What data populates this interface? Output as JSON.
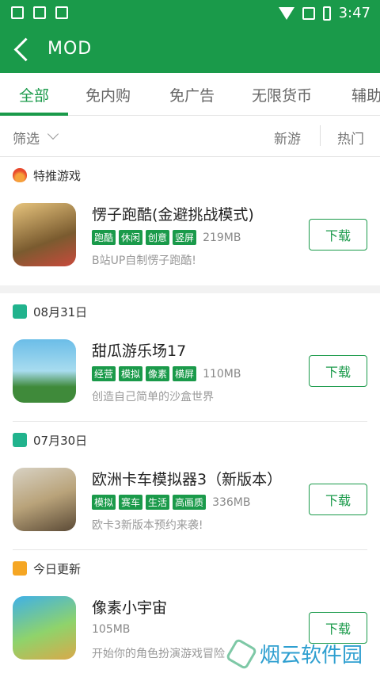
{
  "status": {
    "time": "3:47"
  },
  "appbar": {
    "title": "MOD"
  },
  "tabs": [
    "全部",
    "免内购",
    "免广告",
    "无限货币",
    "辅助"
  ],
  "filter": {
    "label": "筛选",
    "sort_new": "新游",
    "sort_hot": "热门"
  },
  "sections": [
    {
      "title": "特推游戏",
      "icon": "fire-icon"
    },
    {
      "title": "08月31日",
      "icon": "calendar-icon"
    },
    {
      "title": "07月30日",
      "icon": "calendar-icon"
    },
    {
      "title": "今日更新",
      "icon": "calendar-icon"
    }
  ],
  "games": [
    {
      "name": "愣子跑酷(金避挑战模式)",
      "tags": [
        "跑酷",
        "休闲",
        "创意",
        "竖屏"
      ],
      "size": "219MB",
      "desc": "B站UP自制愣子跑酷!",
      "button": "下载"
    },
    {
      "name": "甜瓜游乐场17",
      "tags": [
        "经营",
        "模拟",
        "像素",
        "横屏"
      ],
      "size": "110MB",
      "desc": "创造自己简单的沙盒世界",
      "button": "下载"
    },
    {
      "name": "欧洲卡车模拟器3（新版本）",
      "tags": [
        "模拟",
        "赛车",
        "生活",
        "高画质"
      ],
      "size": "336MB",
      "desc": "欧卡3新版本预约来袭!",
      "button": "下载"
    },
    {
      "name": "像素小宇宙",
      "tags": [],
      "size": "105MB",
      "desc": "开始你的角色扮演游戏冒险",
      "button": "下载"
    }
  ],
  "watermark": {
    "text": "烟云软件园"
  },
  "colors": {
    "primary": "#1a9a4a",
    "calendar": "#21b38d",
    "today": "#f5a623"
  }
}
